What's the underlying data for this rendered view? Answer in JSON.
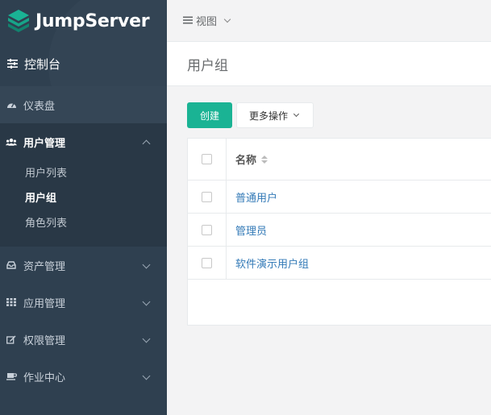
{
  "brand": {
    "name": "JumpServer"
  },
  "sidebar": {
    "console": {
      "label": "控制台",
      "icon": "sliders-icon"
    },
    "items": [
      {
        "label": "仪表盘",
        "icon": "dashboard-icon"
      },
      {
        "label": "用户管理",
        "icon": "users-icon",
        "expanded": true,
        "children": [
          {
            "label": "用户列表"
          },
          {
            "label": "用户组",
            "active": true
          },
          {
            "label": "角色列表"
          }
        ]
      },
      {
        "label": "资产管理",
        "icon": "inbox-icon"
      },
      {
        "label": "应用管理",
        "icon": "grid-icon"
      },
      {
        "label": "权限管理",
        "icon": "edit-icon"
      },
      {
        "label": "作业中心",
        "icon": "coffee-icon"
      }
    ]
  },
  "topbar": {
    "view_label": "视图"
  },
  "page": {
    "title": "用户组"
  },
  "toolbar": {
    "create_label": "创建",
    "more_label": "更多操作"
  },
  "table": {
    "header": {
      "name": "名称"
    },
    "rows": [
      {
        "name": "普通用户"
      },
      {
        "name": "管理员"
      },
      {
        "name": "软件演示用户组"
      }
    ]
  },
  "colors": {
    "sidebar_bg": "#2f4050",
    "accent": "#1ab394",
    "link": "#337ab7"
  }
}
